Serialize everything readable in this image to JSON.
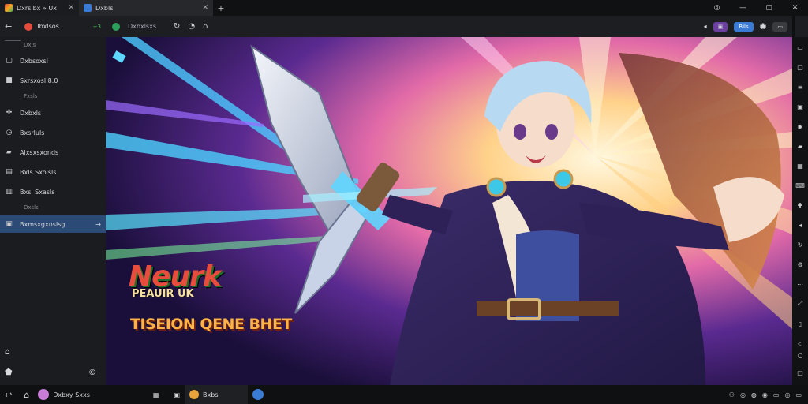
{
  "tabs": [
    {
      "label": "Dxrsibx » Ux",
      "active": false
    },
    {
      "label": "Dxbls",
      "active": true
    }
  ],
  "toolbar": {
    "profile_label": "Ibxlsos",
    "badge": "+3",
    "address": "Dxbxlsxs",
    "btn_blue": "Bils"
  },
  "sidebar": {
    "top_label": "Dxls",
    "items": [
      {
        "label": "Dxbsoxsl",
        "icon": "page-icon"
      },
      {
        "label": "Sxrsxosl 8:0",
        "icon": "folder-icon"
      },
      {
        "label": "Dxbxls",
        "icon": "puzzle-icon"
      },
      {
        "label": "Bxsrluls",
        "icon": "clock-icon"
      },
      {
        "label": "Alxsxsxonds",
        "icon": "folder-open-icon"
      },
      {
        "label": "Bxls Sxolsls",
        "icon": "book-icon"
      },
      {
        "label": "Bxsl Sxasls",
        "icon": "chart-icon"
      },
      {
        "label": "Bxmsxgxnslsg",
        "icon": "gear-icon"
      }
    ],
    "sections": [
      "Fxsls",
      "Dxsls"
    ]
  },
  "hero": {
    "logo_line1": "Neurk",
    "logo_line2": "PEAUIR UK",
    "logo_line3": "TISEION QENE BHET"
  },
  "taskbar": {
    "app_label": "Dxbxy Sxxs",
    "window_label": "Bxbs"
  },
  "colors": {
    "accent_blue": "#2b4a75",
    "chip_blue": "#3a7bd5",
    "chip_purple": "#6b3fa0"
  }
}
